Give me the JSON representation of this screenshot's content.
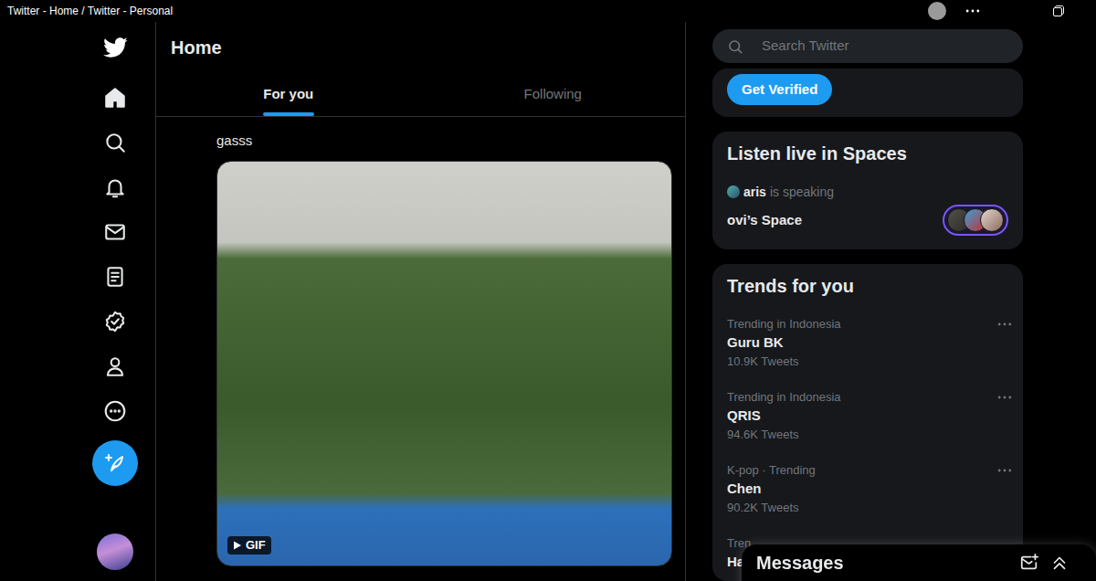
{
  "window": {
    "title": "Twitter - Home / Twitter - Personal"
  },
  "sidebar": {
    "items": [
      {
        "selected": true
      },
      {
        "selected": false
      },
      {
        "selected": false
      },
      {
        "selected": false
      },
      {
        "selected": false
      },
      {
        "selected": false
      },
      {
        "selected": false
      },
      {
        "selected": false
      }
    ]
  },
  "header": {
    "title": "Home"
  },
  "tabs": [
    {
      "label": "For you",
      "selected": true
    },
    {
      "label": "Following",
      "selected": false
    }
  ],
  "tweet": {
    "text": "gasss",
    "media": {
      "badge": "GIF"
    }
  },
  "search": {
    "placeholder": "Search Twitter"
  },
  "verify": {
    "button": "Get Verified"
  },
  "spaces": {
    "title": "Listen live in Spaces",
    "host": "aris",
    "status": "is speaking",
    "name": "ovi’s Space"
  },
  "trends": {
    "title": "Trends for you",
    "items": [
      {
        "context": "Trending in Indonesia",
        "name": "Guru BK",
        "count": "10.9K Tweets"
      },
      {
        "context": "Trending in Indonesia",
        "name": "QRIS",
        "count": "94.6K Tweets"
      },
      {
        "context": "K-pop · Trending",
        "name": "Chen",
        "count": "90.2K Tweets"
      },
      {
        "context": "Tren",
        "name": "Ha"
      }
    ]
  },
  "messages": {
    "title": "Messages"
  }
}
